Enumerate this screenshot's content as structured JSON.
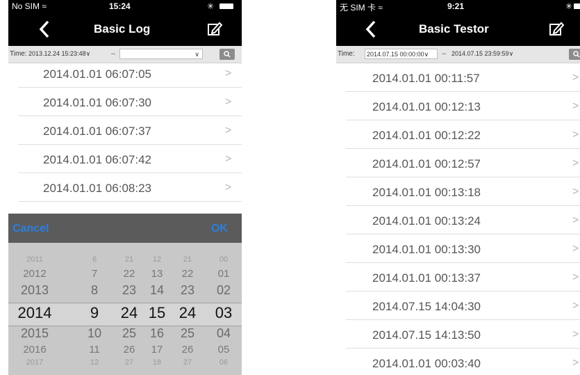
{
  "left": {
    "status": {
      "carrier": "No SIM ≈",
      "time": "15:24",
      "bluetooth": "✳"
    },
    "nav": {
      "back_icon": "chevron-left-icon",
      "title": "Basic Log",
      "edit_icon": "edit-icon"
    },
    "filter": {
      "label": "Time:",
      "start": "2013.12.24 15:23:48∨",
      "separator": "--",
      "end": "",
      "end_caret": "∨"
    },
    "list": [
      "2014.01.01 06:07:05",
      "2014.01.01 06:07:30",
      "2014.01.01 06:07:37",
      "2014.01.01 06:07:42",
      "2014.01.01 06:08:23"
    ],
    "chevron": ">",
    "toolbar": {
      "cancel": "Cancel",
      "ok": "OK"
    },
    "picker": {
      "columns": [
        [
          "2011",
          "2012",
          "2013",
          "2014",
          "2015",
          "2016",
          "2017"
        ],
        [
          "6",
          "7",
          "8",
          "9",
          "10",
          "11",
          "12"
        ],
        [
          "21",
          "22",
          "23",
          "24",
          "25",
          "26",
          "27"
        ],
        [
          "12",
          "13",
          "14",
          "15",
          "16",
          "17",
          "18"
        ],
        [
          "21",
          "22",
          "23",
          "24",
          "25",
          "26",
          "27"
        ],
        [
          "00",
          "01",
          "02",
          "03",
          "04",
          "05",
          "06"
        ]
      ]
    }
  },
  "right": {
    "status": {
      "carrier": "无 SIM 卡 ≈",
      "time": "9:21",
      "bluetooth": "✳"
    },
    "nav": {
      "back_icon": "chevron-left-icon",
      "title": "Basic Testor",
      "edit_icon": "edit-icon"
    },
    "filter": {
      "label": "Time:",
      "start": "2014.07.15 00:00:00∨",
      "separator": "--",
      "end": "2014.07.15 23:59:59∨"
    },
    "list": [
      "2014.01.01 00:11:57",
      "2014.01.01 00:12:13",
      "2014.01.01 00:12:22",
      "2014.01.01 00:12:57",
      "2014.01.01 00:13:18",
      "2014.01.01 00:13:24",
      "2014.01.01 00:13:30",
      "2014.01.01 00:13:37",
      "2014.07.15 14:04:30",
      "2014.07.15 14:13:50",
      "2014.01.01 00:03:40"
    ],
    "chevron": ">"
  }
}
